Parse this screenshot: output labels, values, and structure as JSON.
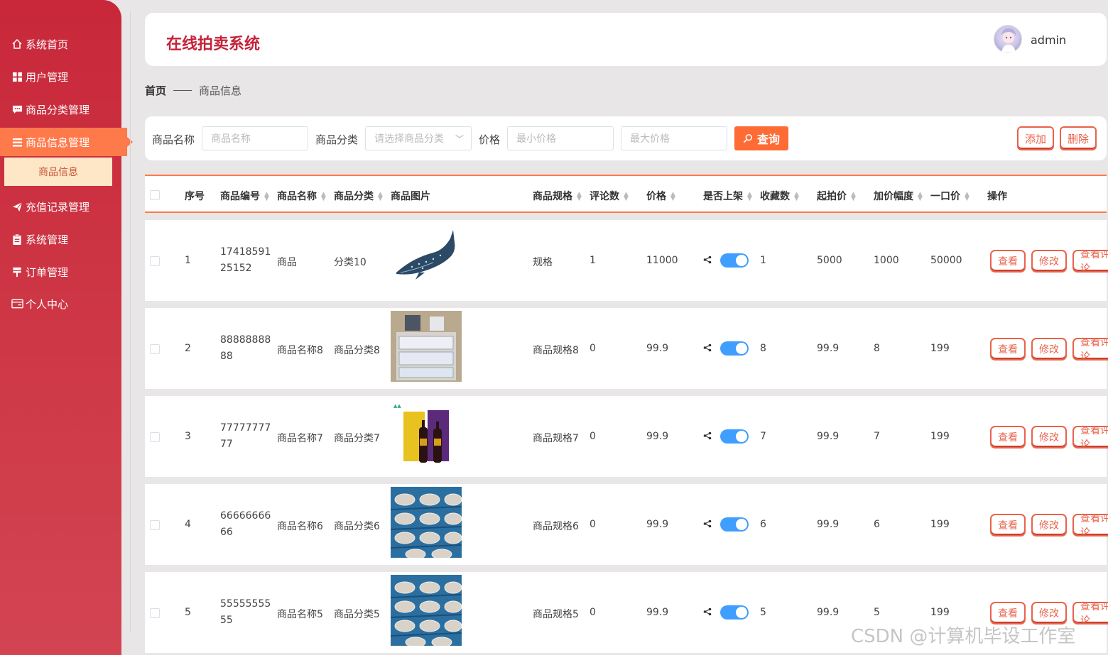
{
  "sidebar": {
    "items": [
      {
        "label": "系统首页",
        "icon": "home-icon"
      },
      {
        "label": "用户管理",
        "icon": "grid-icon"
      },
      {
        "label": "商品分类管理",
        "icon": "chat-icon"
      },
      {
        "label": "商品信息管理",
        "icon": "list-icon"
      },
      {
        "label": "充值记录管理",
        "icon": "send-icon"
      },
      {
        "label": "系统管理",
        "icon": "clipboard-icon"
      },
      {
        "label": "订单管理",
        "icon": "flag-icon"
      },
      {
        "label": "个人中心",
        "icon": "card-icon"
      }
    ],
    "active_sub": "商品信息"
  },
  "header": {
    "title": "在线拍卖系统",
    "username": "admin"
  },
  "breadcrumb": {
    "home": "首页",
    "current": "商品信息"
  },
  "search": {
    "name_label": "商品名称",
    "name_placeholder": "商品名称",
    "category_label": "商品分类",
    "category_placeholder": "请选择商品分类",
    "price_label": "价格",
    "min_placeholder": "最小价格",
    "max_placeholder": "最大价格",
    "query_label": "查询",
    "add_label": "添加",
    "delete_label": "删除"
  },
  "table": {
    "headers": [
      "序号",
      "商品编号",
      "商品名称",
      "商品分类",
      "商品图片",
      "商品规格",
      "评论数",
      "价格",
      "是否上架",
      "收藏数",
      "起拍价",
      "加价幅度",
      "一口价",
      "操作"
    ],
    "rows": [
      {
        "index": "1",
        "code": "1741859125152",
        "name": "商品",
        "category": "分类10",
        "image": "whale-shark",
        "spec": "规格",
        "comments": "1",
        "price": "11000",
        "on_shelf": true,
        "favorites": "1",
        "start_price": "5000",
        "increment": "1000",
        "buyout": "50000"
      },
      {
        "index": "2",
        "code": "8888888888",
        "name": "商品名称8",
        "category": "商品分类8",
        "image": "storage-drawers",
        "spec": "商品规格8",
        "comments": "0",
        "price": "99.9",
        "on_shelf": true,
        "favorites": "8",
        "start_price": "99.9",
        "increment": "8",
        "buyout": "199"
      },
      {
        "index": "3",
        "code": "7777777777",
        "name": "商品名称7",
        "category": "商品分类7",
        "image": "wine-gift-box",
        "spec": "商品规格7",
        "comments": "0",
        "price": "99.9",
        "on_shelf": true,
        "favorites": "7",
        "start_price": "99.9",
        "increment": "7",
        "buyout": "199"
      },
      {
        "index": "4",
        "code": "6666666666",
        "name": "商品名称6",
        "category": "商品分类6",
        "image": "fish-tray",
        "spec": "商品规格6",
        "comments": "0",
        "price": "99.9",
        "on_shelf": true,
        "favorites": "6",
        "start_price": "99.9",
        "increment": "6",
        "buyout": "199"
      },
      {
        "index": "5",
        "code": "5555555555",
        "name": "商品名称5",
        "category": "商品分类5",
        "image": "fish-tray",
        "spec": "商品规格5",
        "comments": "0",
        "price": "99.9",
        "on_shelf": true,
        "favorites": "5",
        "start_price": "99.9",
        "increment": "5",
        "buyout": "199"
      }
    ],
    "actions": {
      "view": "查看",
      "edit": "修改",
      "more": "查看评论"
    }
  },
  "watermark": "CSDN @计算机毕设工作室",
  "colors": {
    "sidebar": "#c8283a",
    "accent": "#ff7a4b",
    "toggle_on": "#409eff",
    "title": "#c4233a"
  }
}
